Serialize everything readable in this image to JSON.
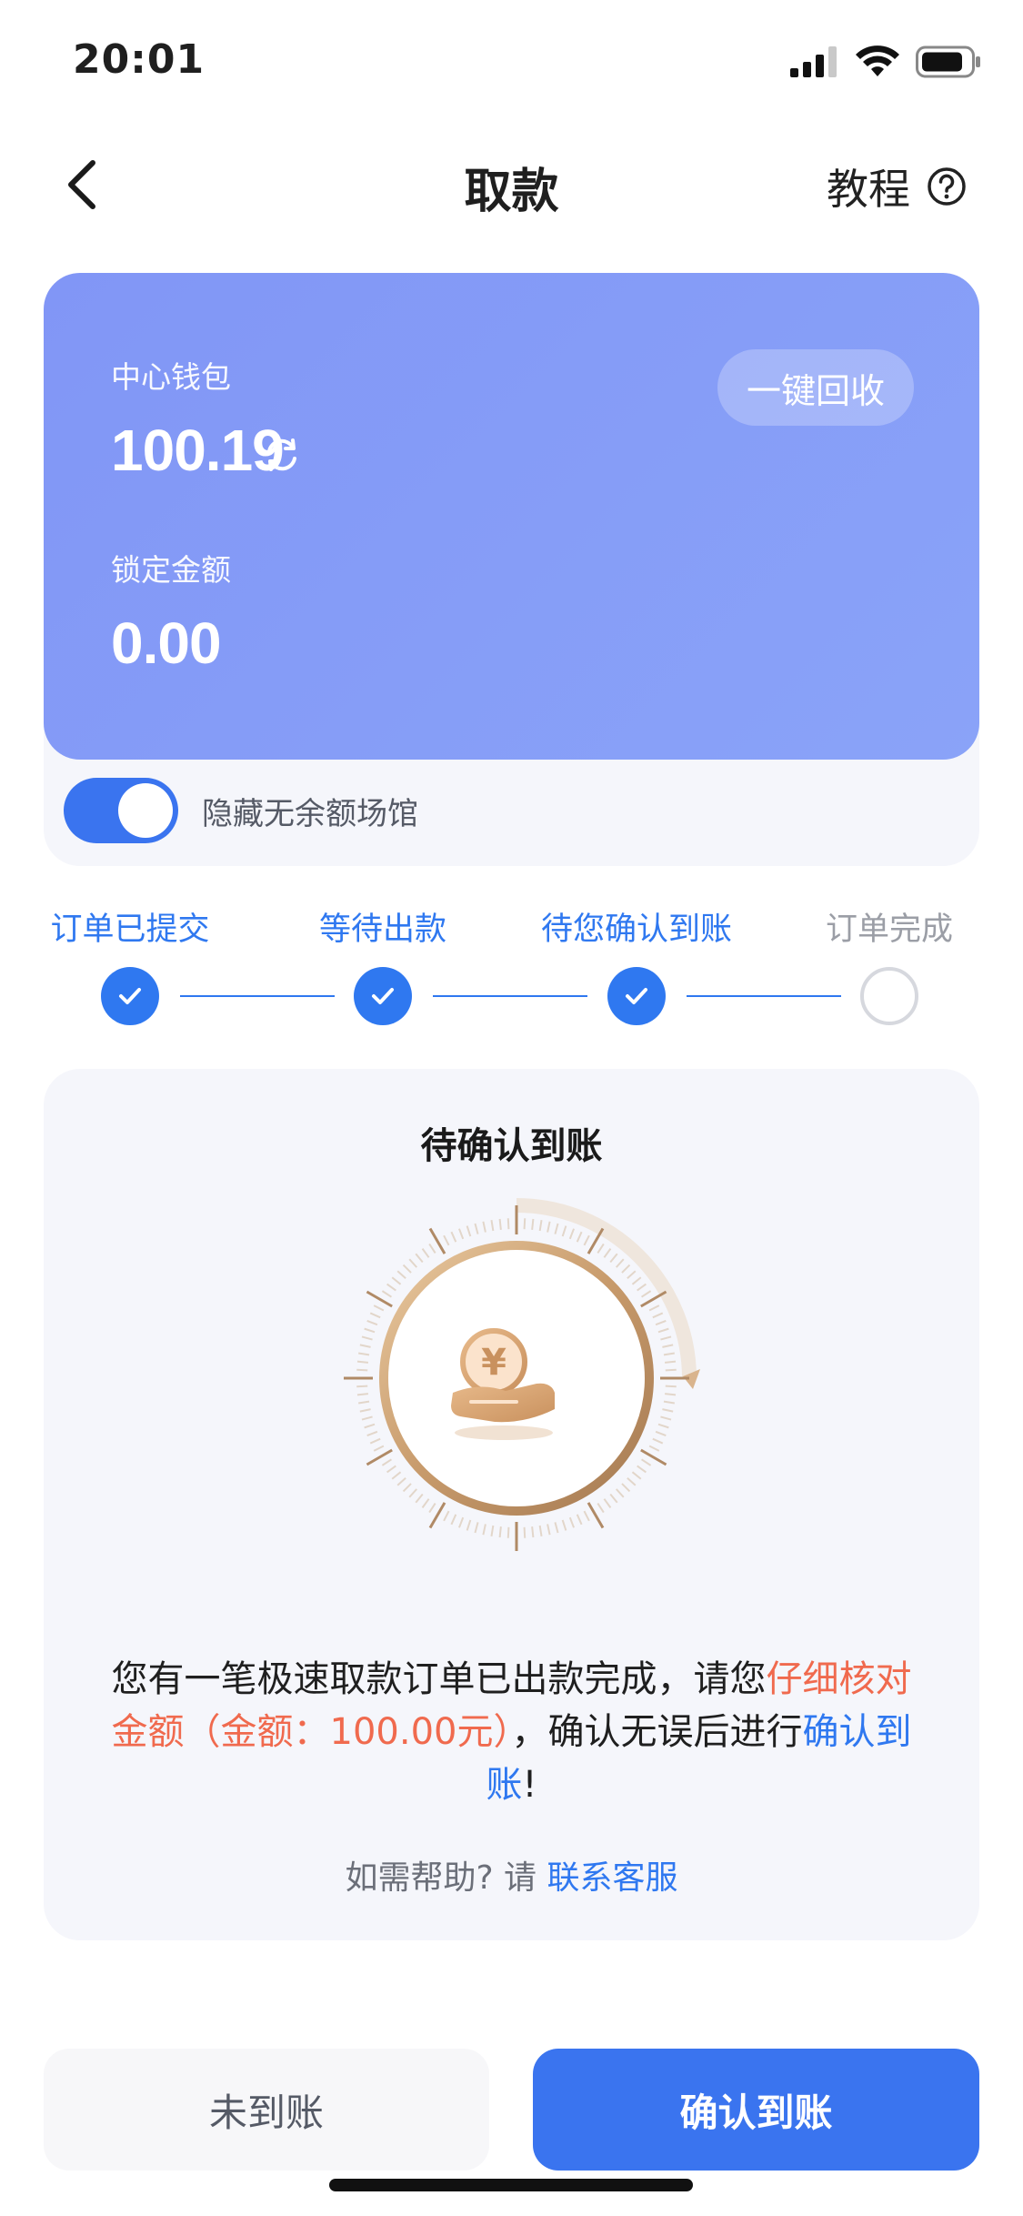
{
  "status_bar": {
    "time": "20:01"
  },
  "nav": {
    "title": "取款",
    "tutorial_label": "教程"
  },
  "wallet": {
    "center_wallet_label": "中心钱包",
    "center_wallet_value": "100.19",
    "locked_label": "锁定金额",
    "locked_value": "0.00",
    "recycle_label": "一键回收",
    "hide_toggle_label": "隐藏无余额场馆",
    "hide_toggle_on": true
  },
  "steps": [
    {
      "label": "订单已提交",
      "status": "done"
    },
    {
      "label": "等待出款",
      "status": "done"
    },
    {
      "label": "待您确认到账",
      "status": "done"
    },
    {
      "label": "订单完成",
      "status": "todo"
    }
  ],
  "main": {
    "title": "待确认到账",
    "message_part1": "您有一笔极速取款订单已出款完成，请您",
    "message_red": "仔细核对金额（金额：100.00元）",
    "message_part2": "，确认无误后进行",
    "message_blue": "确认到账",
    "message_end": "!",
    "help_prefix": "如需帮助? 请 ",
    "help_link": "联系客服"
  },
  "buttons": {
    "not_received": "未到账",
    "confirm_received": "确认到账"
  },
  "colors": {
    "primary": "#3a74ef",
    "step_active": "#2f78f0",
    "highlight_red": "#f06a4e",
    "card_gradient_start": "#8196f6",
    "card_gradient_end": "#8aa3f8"
  },
  "icons": {
    "back": "chevron-left-icon",
    "help": "question-circle-icon",
    "refresh": "refresh-icon",
    "coin_hand": "coin-hand-icon",
    "check": "check-icon"
  }
}
